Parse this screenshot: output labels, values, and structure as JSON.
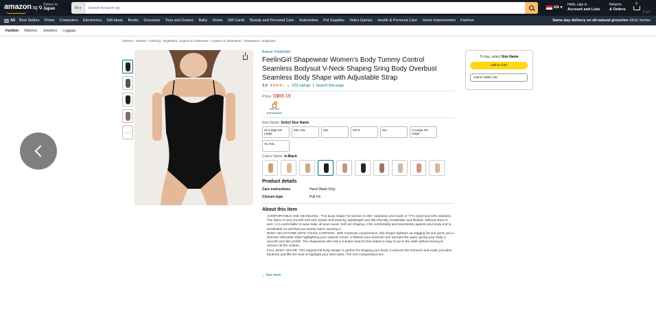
{
  "header": {
    "logo": "amazon",
    "logo_suffix": ".sg",
    "deliver_label": "Deliver to",
    "deliver_location": "Japan",
    "search_category": "All",
    "search_placeholder": "Search Amazon.sg",
    "language": "EN",
    "account_line1": "Hello, sign in",
    "account_line2": "Account and Lists",
    "returns_line1": "Returns",
    "returns_line2": "& Orders",
    "cart_count": "0",
    "cart_label": "Cart"
  },
  "nav": {
    "all_label": "All",
    "items": [
      "Best Sellers",
      "Prime",
      "Computers",
      "Electronics",
      "Gift Ideas",
      "Books",
      "Groceries",
      "Toys and Games",
      "Baby",
      "Home",
      "Gift Cards",
      "Beauty and Personal Care",
      "Automotive",
      "Pet Supplies",
      "Video Games",
      "Health & Personal Care",
      "Home Improvement",
      "Fashion"
    ],
    "promo": "Same-day delivery on all-natural groceries",
    "promo_brand": "little farms"
  },
  "subnav": [
    "Fashion",
    "Watches",
    "Jewellery",
    "Luggage"
  ],
  "breadcrumb": "Fashion › Women › Clothing › Nightwear, Lingerie & Underwear › Lingerie & Underwear › Shapewear › Bodysuits",
  "product": {
    "brand": "Brand: FeelinGirl",
    "title": "FeelinGirl Shapewear Women's Body Tummy Control Seamless Bodysuit V-Neck Shaping Sring Body Overbust Seamless Body Shape with Adjustable Strap",
    "rating": "3.9",
    "stars": "★★★★☆",
    "ratings_count": "222 ratings",
    "search_page": "Search this page",
    "price_label": "Price:",
    "price": "S$65.19",
    "secure_label": "Secure transaction",
    "size_label": "Size Name:",
    "size_selected": "Select Size Name",
    "sizes": [
      "3X-Large-4X-Large",
      "3XL-4XL",
      "3XL",
      "XS-S",
      "M-L",
      "X-Large-XX-Large",
      "XL-XXL"
    ],
    "colour_label": "Colour Name:",
    "colour_selected": "A-Black",
    "colour_swatches": [
      "#c8a07a",
      "#d9b99a",
      "#caa88a",
      "#1e1e1e",
      "#c9967a",
      "#2a2626",
      "#9a7565",
      "#d2b8a3",
      "#c79a80",
      "#d8b59a"
    ],
    "details_heading": "Product details",
    "details": [
      {
        "k": "Care instructions",
        "v": "Hand Wash Only"
      },
      {
        "k": "Closure type",
        "v": "Pull On"
      }
    ],
    "about_heading": "About this item",
    "bullets": [
      "COMFORTABLE AND SEAMLESS : This body shaper for women is 360° seamless and made of 77% nylon and 23% elastane. The fabric is very smooth and soft, elastic and stretchy, lightweight and skin-friendly, breathable and flexible. Without steel or wire, it is comfortable to wear daily, all year round. Soft yet shaping, it fits comfortably and seamlessly against your body and is breathable so well that you barely notice wearing it.",
      "BODY SKULPTURE WITH Tummy CONTROL: With moderate compression, this shaper tightens up sagging fat and gives you a slimmer silhouette while highlighting your natural curves. It flattens your stomach and narrows the waist, giving your body a smooth and slim profile. The shapewear also has a 2 button branch that makes it easy to go to the toilet without having to remove all the clothes.",
      "FULL BODY SHAPE: This elegant full body shaper is perfect for shaping your body. It reduces the stomach and waist, provides backrest and lifts the bust to highlight your best sides. The non-compressive bra"
    ],
    "see_more": "See more"
  },
  "buybox": {
    "prompt": "To buy, select",
    "prompt_bold": "Size Name",
    "add_to_cart": "Add to Cart",
    "add_to_wishlist": "Add to Wish List"
  }
}
